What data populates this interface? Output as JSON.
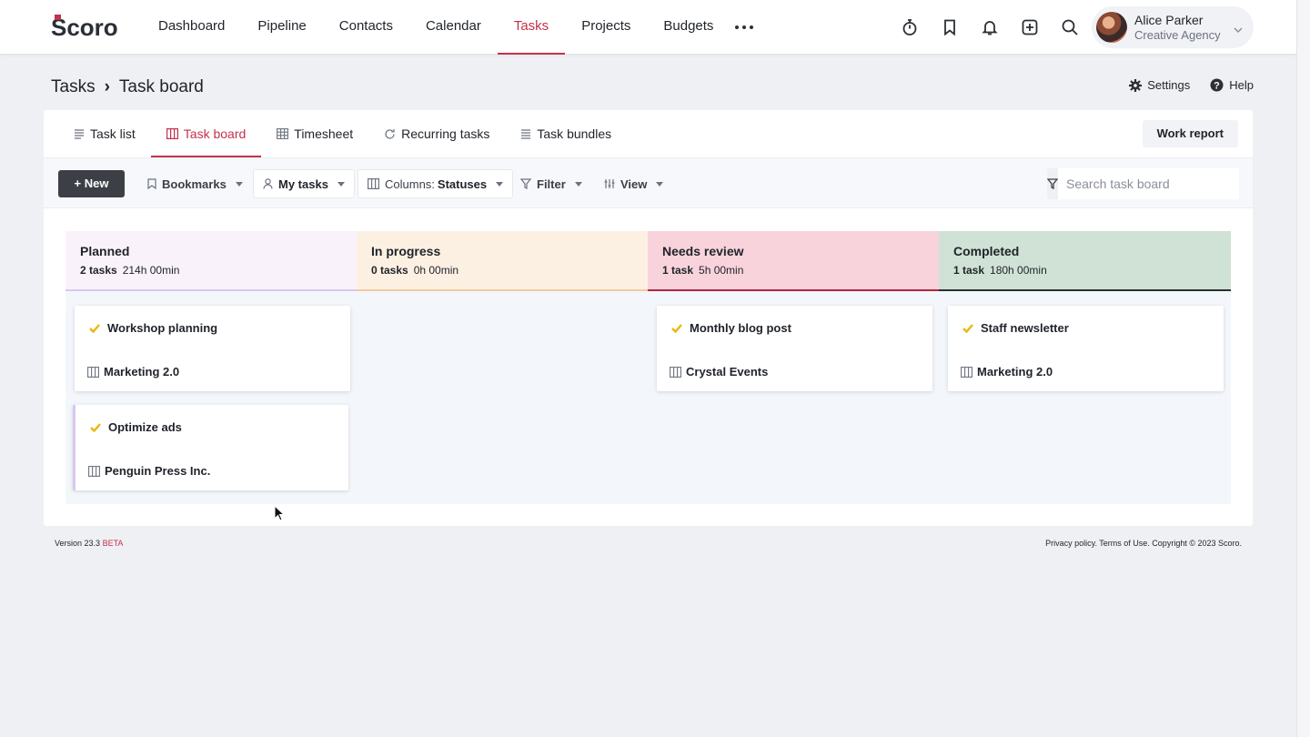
{
  "app": {
    "logo_text": "Scoro"
  },
  "nav": {
    "items": [
      {
        "label": "Dashboard"
      },
      {
        "label": "Pipeline"
      },
      {
        "label": "Contacts"
      },
      {
        "label": "Calendar"
      },
      {
        "label": "Tasks"
      },
      {
        "label": "Projects"
      },
      {
        "label": "Budgets"
      }
    ],
    "active_index": 4
  },
  "user": {
    "name": "Alice Parker",
    "org": "Creative Agency"
  },
  "breadcrumb": {
    "parent": "Tasks",
    "separator": "›",
    "current": "Task board"
  },
  "header_actions": {
    "settings": "Settings",
    "help": "Help"
  },
  "subtabs": [
    {
      "label": "Task list",
      "icon": "list-icon"
    },
    {
      "label": "Task board",
      "icon": "board-icon"
    },
    {
      "label": "Timesheet",
      "icon": "grid-icon"
    },
    {
      "label": "Recurring tasks",
      "icon": "refresh-icon"
    },
    {
      "label": "Task bundles",
      "icon": "bundle-icon"
    }
  ],
  "work_report": "Work report",
  "toolbar": {
    "new_label": "+ New",
    "bookmarks": "Bookmarks",
    "my_tasks": "My tasks",
    "columns_prefix": "Columns:",
    "columns_value": "Statuses",
    "filter": "Filter",
    "view": "View",
    "search_placeholder": "Search task board"
  },
  "columns": [
    {
      "title": "Planned",
      "count": "2 tasks",
      "time": "214h 00min",
      "bg": "#faf2fb",
      "border": "#d8c8ee"
    },
    {
      "title": "In progress",
      "count": "0 tasks",
      "time": "0h 00min",
      "bg": "#fcf0e3",
      "border": "#f4c9a0"
    },
    {
      "title": "Needs review",
      "count": "1 task",
      "time": "5h 00min",
      "bg": "#f8d3dc",
      "border": "#b0283f"
    },
    {
      "title": "Completed",
      "count": "1 task",
      "time": "180h 00min",
      "bg": "#cfe2d5",
      "border": "#2a2e33"
    }
  ],
  "cards": [
    {
      "title": "Workshop planning",
      "project": "Marketing 2.0"
    },
    {
      "title": "Optimize ads",
      "project": "Penguin Press Inc."
    },
    {
      "title": "Monthly blog post",
      "project": "Crystal Events"
    },
    {
      "title": "Staff newsletter",
      "project": "Marketing 2.0"
    }
  ],
  "footer": {
    "version": "Version 23.3",
    "beta": "BETA",
    "legal": "Privacy policy. Terms of Use. Copyright © 2023 Scoro."
  },
  "colors": {
    "accent": "#c4314b",
    "check": "#e8b70c"
  }
}
